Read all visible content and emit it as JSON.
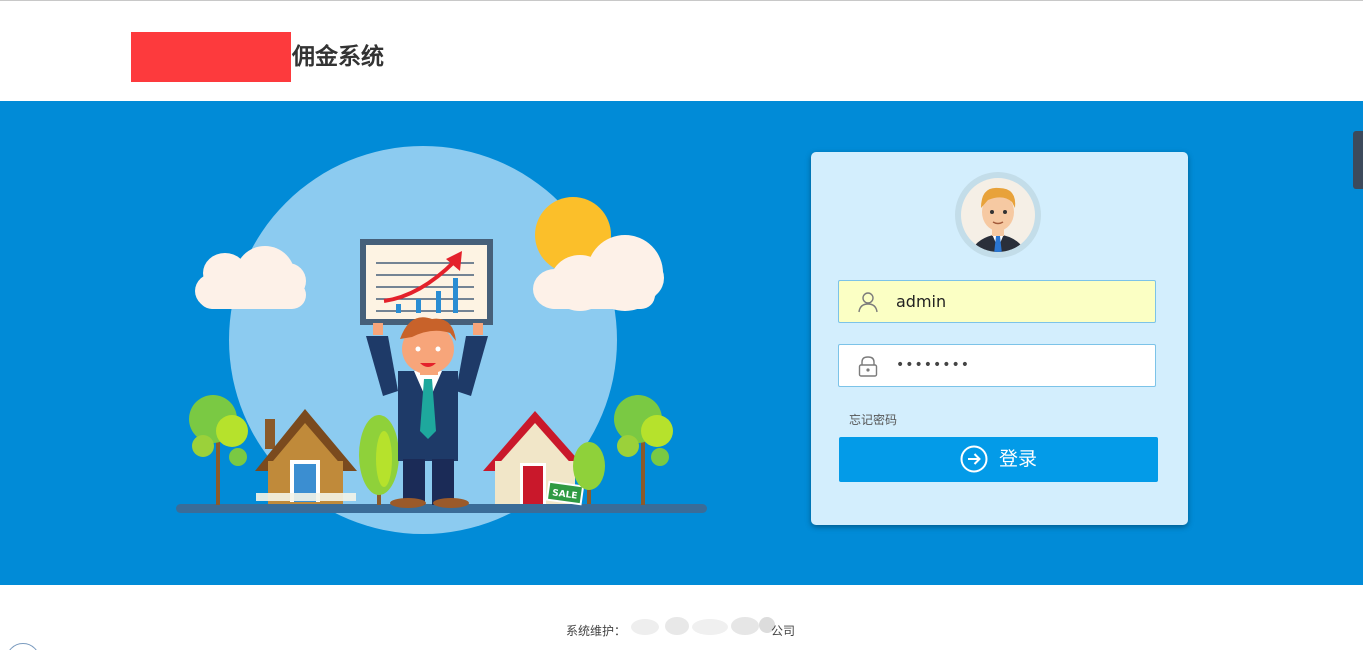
{
  "header": {
    "app_title": "佣金系统"
  },
  "login": {
    "username_value": "admin",
    "password_value": "••••••••",
    "forgot_password": "忘记密码",
    "login_button": "登录"
  },
  "footer": {
    "maintenance_label": "系统维护：",
    "company_suffix": "公司"
  },
  "icons": {
    "user": "user-icon",
    "lock": "lock-icon",
    "arrow": "arrow-right-circle-icon"
  },
  "colors": {
    "banner": "#018bd7",
    "card": "#d3eefd",
    "button": "#039be8",
    "username_bg": "#fbffc4",
    "logo_block": "#fd3a3d"
  }
}
